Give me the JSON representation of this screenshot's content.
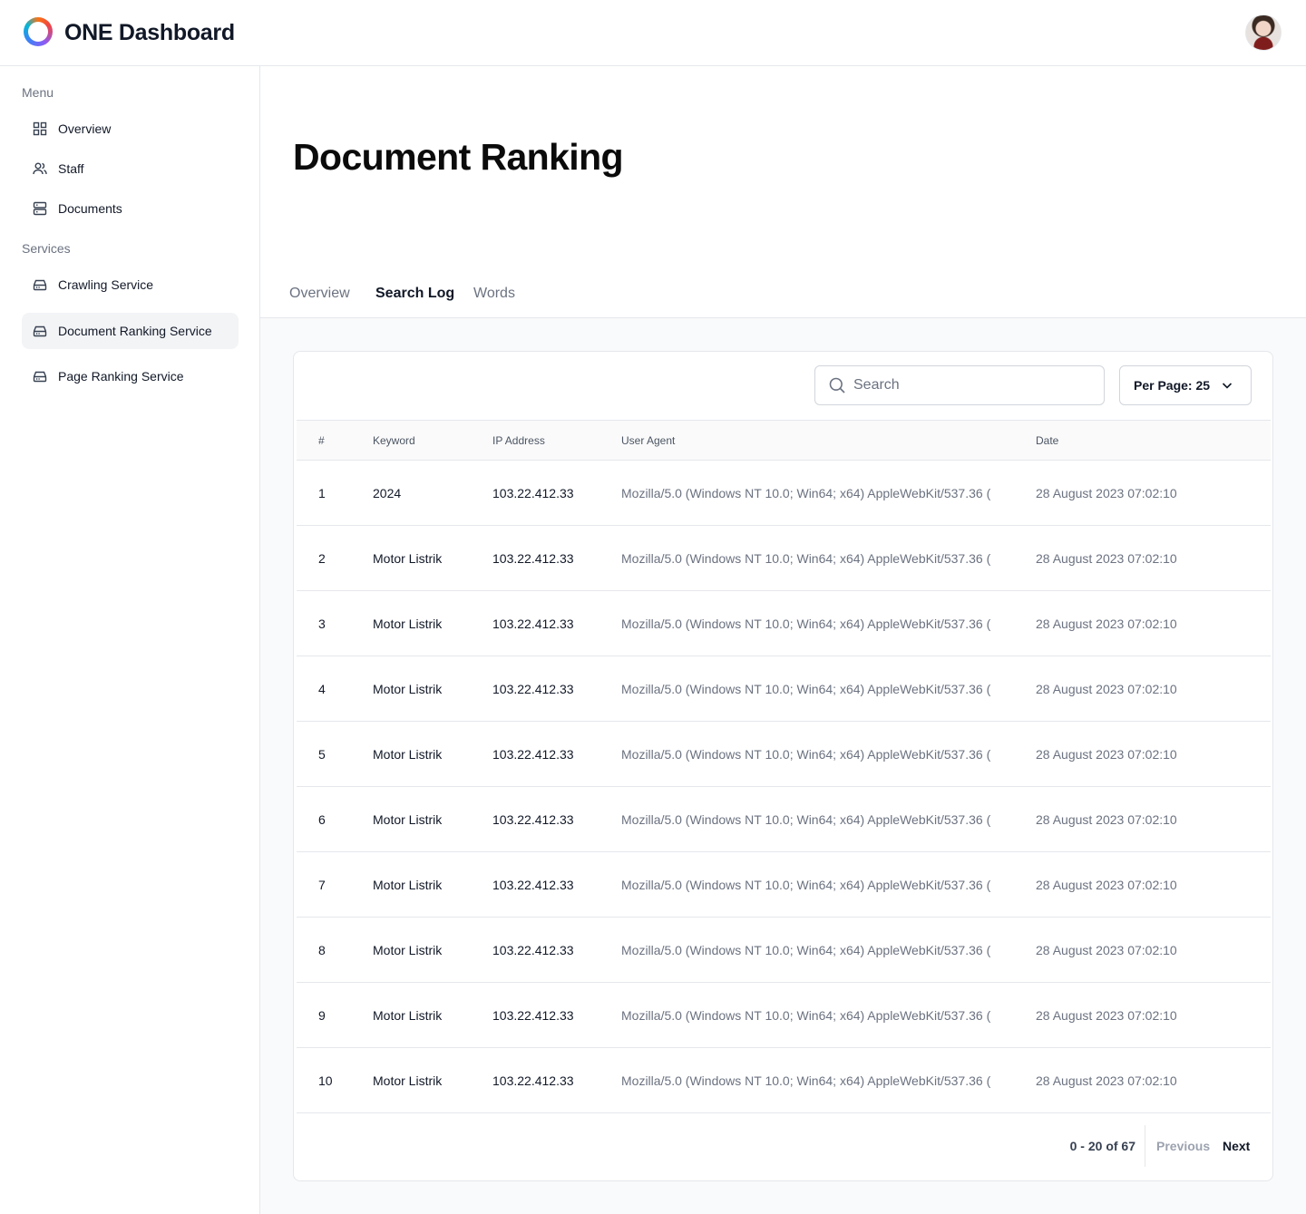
{
  "app": {
    "title": "ONE Dashboard"
  },
  "icons": {
    "logo": "ring-logo-icon",
    "overview": "grid-icon",
    "staff": "users-icon",
    "documents": "server-icon",
    "service": "hard-drive-icon",
    "search": "search-icon",
    "chevron": "chevron-down-icon"
  },
  "colors": {
    "active_bg": "#f3f4f6",
    "border": "#e5e7eb",
    "muted": "#6b7280"
  },
  "sidebar": {
    "menu_heading": "Menu",
    "services_heading": "Services",
    "menu_items": [
      {
        "label": "Overview"
      },
      {
        "label": "Staff"
      },
      {
        "label": "Documents"
      }
    ],
    "service_items": [
      {
        "label": "Crawling Service"
      },
      {
        "label": "Document Ranking Service"
      },
      {
        "label": "Page Ranking Service"
      }
    ],
    "active": "Document Ranking Service"
  },
  "page": {
    "title": "Document Ranking"
  },
  "tabs": [
    {
      "label": "Overview"
    },
    {
      "label": "Search Log"
    },
    {
      "label": "Words"
    }
  ],
  "active_tab": "Search Log",
  "toolbar": {
    "search_placeholder": "Search",
    "per_page_label": "Per Page: 25"
  },
  "table": {
    "headers": [
      "#",
      "Keyword",
      "IP Address",
      "User Agent",
      "Date"
    ],
    "rows": [
      [
        "1",
        "2024",
        "103.22.412.33",
        "Mozilla/5.0 (Windows NT 10.0; Win64; x64) AppleWebKit/537.36 (",
        "28 August 2023 07:02:10"
      ],
      [
        "2",
        "Motor Listrik",
        "103.22.412.33",
        "Mozilla/5.0 (Windows NT 10.0; Win64; x64) AppleWebKit/537.36 (",
        "28 August 2023 07:02:10"
      ],
      [
        "3",
        "Motor Listrik",
        "103.22.412.33",
        "Mozilla/5.0 (Windows NT 10.0; Win64; x64) AppleWebKit/537.36 (",
        "28 August 2023 07:02:10"
      ],
      [
        "4",
        "Motor Listrik",
        "103.22.412.33",
        "Mozilla/5.0 (Windows NT 10.0; Win64; x64) AppleWebKit/537.36 (",
        "28 August 2023 07:02:10"
      ],
      [
        "5",
        "Motor Listrik",
        "103.22.412.33",
        "Mozilla/5.0 (Windows NT 10.0; Win64; x64) AppleWebKit/537.36 (",
        "28 August 2023 07:02:10"
      ],
      [
        "6",
        "Motor Listrik",
        "103.22.412.33",
        "Mozilla/5.0 (Windows NT 10.0; Win64; x64) AppleWebKit/537.36 (",
        "28 August 2023 07:02:10"
      ],
      [
        "7",
        "Motor Listrik",
        "103.22.412.33",
        "Mozilla/5.0 (Windows NT 10.0; Win64; x64) AppleWebKit/537.36 (",
        "28 August 2023 07:02:10"
      ],
      [
        "8",
        "Motor Listrik",
        "103.22.412.33",
        "Mozilla/5.0 (Windows NT 10.0; Win64; x64) AppleWebKit/537.36 (",
        "28 August 2023 07:02:10"
      ],
      [
        "9",
        "Motor Listrik",
        "103.22.412.33",
        "Mozilla/5.0 (Windows NT 10.0; Win64; x64) AppleWebKit/537.36 (",
        "28 August 2023 07:02:10"
      ],
      [
        "10",
        "Motor Listrik",
        "103.22.412.33",
        "Mozilla/5.0 (Windows NT 10.0; Win64; x64) AppleWebKit/537.36 (",
        "28 August 2023 07:02:10"
      ]
    ]
  },
  "pagination": {
    "summary": "0 - 20 of 67",
    "previous_label": "Previous",
    "next_label": "Next"
  }
}
